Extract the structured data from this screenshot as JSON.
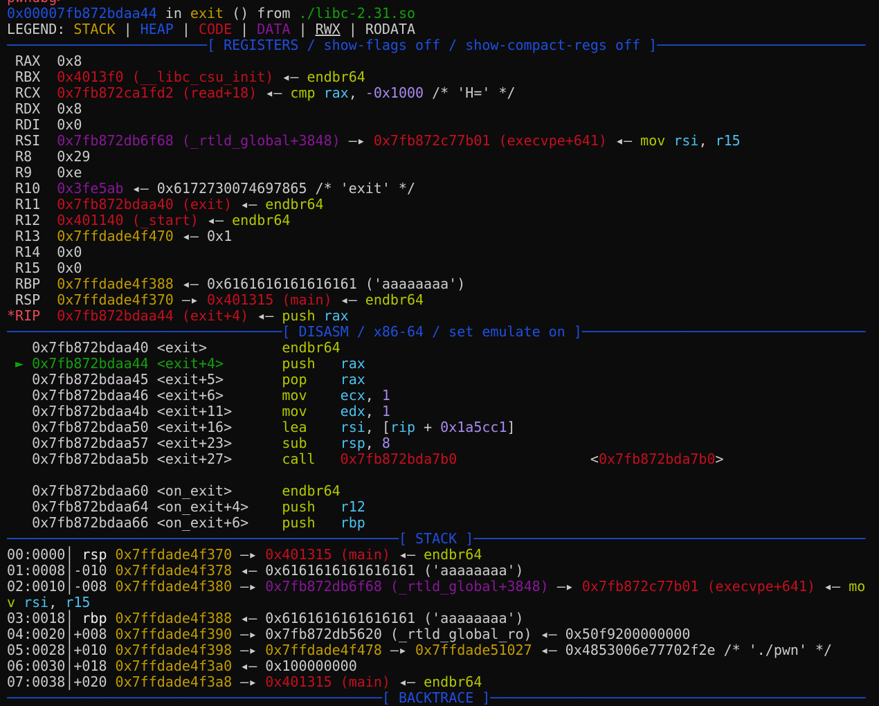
{
  "terminal": {
    "colors": {
      "blue": "#1f4fe0",
      "red": "#c50f1f",
      "green": "#13a10e",
      "yellow": "#c19c00",
      "purple": "#881798",
      "lime": "#b4c800",
      "cyan": "#4cc2f0",
      "text": "#cccccc",
      "background": "#0c0c0c"
    },
    "lines": [
      {
        "s": [
          [
            "pwndbg>",
            "rr"
          ]
        ]
      },
      {
        "s": [
          [
            "0x00007fb872bdaa44",
            "b"
          ],
          [
            " in ",
            "w"
          ],
          [
            "exit",
            "y"
          ],
          [
            " () from ",
            "w"
          ],
          [
            "./libc-2.31.so",
            "g"
          ]
        ]
      },
      {
        "s": [
          [
            "LEGEND: ",
            "w"
          ],
          [
            "STACK",
            "y"
          ],
          [
            " | ",
            "w"
          ],
          [
            "HEAP",
            "b"
          ],
          [
            " | ",
            "w"
          ],
          [
            "CODE",
            "r"
          ],
          [
            " | ",
            "w"
          ],
          [
            "DATA",
            "m"
          ],
          [
            " | ",
            "w"
          ],
          [
            "RWX",
            "w u"
          ],
          [
            " | ",
            "w"
          ],
          [
            "RODATA",
            "w"
          ]
        ]
      },
      {
        "sep": "[ REGISTERS / show-flags off / show-compact-regs off ]"
      },
      {
        "s": [
          [
            " RAX  0x8",
            "w"
          ]
        ]
      },
      {
        "s": [
          [
            " RBX  ",
            "w"
          ],
          [
            "0x4013f0 (__libc_csu_init)",
            "r"
          ],
          [
            " ◂— ",
            "w"
          ],
          [
            "endbr64",
            "yg"
          ]
        ]
      },
      {
        "s": [
          [
            " RCX  ",
            "w"
          ],
          [
            "0x7fb872ca1fd2 (read+18)",
            "r"
          ],
          [
            " ◂— ",
            "w"
          ],
          [
            "cmp ",
            "yg"
          ],
          [
            "rax",
            "c"
          ],
          [
            ", ",
            "w"
          ],
          [
            "-0x1000",
            "p"
          ],
          [
            " /* 'H=' */",
            "w"
          ]
        ]
      },
      {
        "s": [
          [
            " RDX  0x8",
            "w"
          ]
        ]
      },
      {
        "s": [
          [
            " RDI  0x0",
            "w"
          ]
        ]
      },
      {
        "s": [
          [
            " RSI  ",
            "w"
          ],
          [
            "0x7fb872db6f68 (_rtld_global+3848)",
            "m"
          ],
          [
            " —▸ ",
            "w"
          ],
          [
            "0x7fb872c77b01 (execvpe+641)",
            "r"
          ],
          [
            " ◂— ",
            "w"
          ],
          [
            "mov ",
            "yg"
          ],
          [
            "rsi",
            "c"
          ],
          [
            ", ",
            "w"
          ],
          [
            "r15",
            "c"
          ]
        ]
      },
      {
        "s": [
          [
            " R8   0x29",
            "w"
          ]
        ]
      },
      {
        "s": [
          [
            " R9   0xe",
            "w"
          ]
        ]
      },
      {
        "s": [
          [
            " R10  ",
            "w"
          ],
          [
            "0x3fe5ab",
            "m"
          ],
          [
            " ◂— 0x6172730074697865 /* 'exit' */",
            "w"
          ]
        ]
      },
      {
        "s": [
          [
            " R11  ",
            "w"
          ],
          [
            "0x7fb872bdaa40 (exit)",
            "r"
          ],
          [
            " ◂— ",
            "w"
          ],
          [
            "endbr64",
            "yg"
          ]
        ]
      },
      {
        "s": [
          [
            " R12  ",
            "w"
          ],
          [
            "0x401140 (_start)",
            "r"
          ],
          [
            " ◂— ",
            "w"
          ],
          [
            "endbr64",
            "yg"
          ]
        ]
      },
      {
        "s": [
          [
            " R13  ",
            "w"
          ],
          [
            "0x7ffdade4f470",
            "y"
          ],
          [
            " ◂— 0x1",
            "w"
          ]
        ]
      },
      {
        "s": [
          [
            " R14  0x0",
            "w"
          ]
        ]
      },
      {
        "s": [
          [
            " R15  0x0",
            "w"
          ]
        ]
      },
      {
        "s": [
          [
            " RBP  ",
            "w"
          ],
          [
            "0x7ffdade4f388",
            "y"
          ],
          [
            " ◂— 0x6161616161616161 ('aaaaaaaa')",
            "w"
          ]
        ]
      },
      {
        "s": [
          [
            " RSP  ",
            "w"
          ],
          [
            "0x7ffdade4f370",
            "y"
          ],
          [
            " —▸ ",
            "w"
          ],
          [
            "0x401315 (main)",
            "r"
          ],
          [
            " ◂— ",
            "w"
          ],
          [
            "endbr64",
            "yg"
          ]
        ]
      },
      {
        "s": [
          [
            "*RIP  ",
            "rr"
          ],
          [
            "0x7fb872bdaa44 (exit+4)",
            "r"
          ],
          [
            " ◂— ",
            "w"
          ],
          [
            "push ",
            "yg"
          ],
          [
            "rax",
            "c"
          ]
        ]
      },
      {
        "sep": "[ DISASM / x86-64 / set emulate on ]"
      },
      {
        "s": [
          [
            "   0x7fb872bdaa40 <exit>         ",
            "w"
          ],
          [
            "endbr64",
            "yg"
          ]
        ]
      },
      {
        "s": [
          [
            " ► ",
            "g"
          ],
          [
            "0x7fb872bdaa44 <exit+4>",
            "g"
          ],
          [
            "       ",
            "w"
          ],
          [
            "push   ",
            "yg"
          ],
          [
            "rax",
            "c"
          ]
        ]
      },
      {
        "s": [
          [
            "   0x7fb872bdaa45 <exit+5>       ",
            "w"
          ],
          [
            "pop    ",
            "yg"
          ],
          [
            "rax",
            "c"
          ]
        ]
      },
      {
        "s": [
          [
            "   0x7fb872bdaa46 <exit+6>       ",
            "w"
          ],
          [
            "mov    ",
            "yg"
          ],
          [
            "ecx",
            "c"
          ],
          [
            ", ",
            "w"
          ],
          [
            "1",
            "p"
          ]
        ]
      },
      {
        "s": [
          [
            "   0x7fb872bdaa4b <exit+11>      ",
            "w"
          ],
          [
            "mov    ",
            "yg"
          ],
          [
            "edx",
            "c"
          ],
          [
            ", ",
            "w"
          ],
          [
            "1",
            "p"
          ]
        ]
      },
      {
        "s": [
          [
            "   0x7fb872bdaa50 <exit+16>      ",
            "w"
          ],
          [
            "lea    ",
            "yg"
          ],
          [
            "rsi",
            "c"
          ],
          [
            ", [",
            "w"
          ],
          [
            "rip",
            "c"
          ],
          [
            " + ",
            "w"
          ],
          [
            "0x1a5cc1",
            "p"
          ],
          [
            "]",
            "w"
          ]
        ]
      },
      {
        "s": [
          [
            "   0x7fb872bdaa57 <exit+23>      ",
            "w"
          ],
          [
            "sub    ",
            "yg"
          ],
          [
            "rsp",
            "c"
          ],
          [
            ", ",
            "w"
          ],
          [
            "8",
            "p"
          ]
        ]
      },
      {
        "s": [
          [
            "   0x7fb872bdaa5b <exit+27>      ",
            "w"
          ],
          [
            "call   ",
            "yg"
          ],
          [
            "0x7fb872bda7b0",
            "r"
          ],
          [
            "                ",
            "w"
          ],
          [
            "<",
            "w"
          ],
          [
            "0x7fb872bda7b0",
            "r"
          ],
          [
            ">",
            "w"
          ]
        ]
      },
      {
        "s": [
          [
            "",
            "w"
          ]
        ]
      },
      {
        "s": [
          [
            "   0x7fb872bdaa60 <on_exit>      ",
            "w"
          ],
          [
            "endbr64",
            "yg"
          ]
        ]
      },
      {
        "s": [
          [
            "   0x7fb872bdaa64 <on_exit+4>    ",
            "w"
          ],
          [
            "push   ",
            "yg"
          ],
          [
            "r12",
            "c"
          ]
        ]
      },
      {
        "s": [
          [
            "   0x7fb872bdaa66 <on_exit+6>    ",
            "w"
          ],
          [
            "push   ",
            "yg"
          ],
          [
            "rbp",
            "c"
          ]
        ]
      },
      {
        "sep": "[ STACK ]"
      },
      {
        "s": [
          [
            "00:0000│ ",
            "w"
          ],
          [
            "rsp",
            "bw"
          ],
          [
            " ",
            "w"
          ],
          [
            "0x7ffdade4f370",
            "y"
          ],
          [
            " —▸ ",
            "w"
          ],
          [
            "0x401315 (main)",
            "r"
          ],
          [
            " ◂— ",
            "w"
          ],
          [
            "endbr64",
            "yg"
          ]
        ]
      },
      {
        "s": [
          [
            "01:0008│-010 ",
            "w"
          ],
          [
            "0x7ffdade4f378",
            "y"
          ],
          [
            " ◂— 0x6161616161616161 ('aaaaaaaa')",
            "w"
          ]
        ]
      },
      {
        "s": [
          [
            "02:0010│-008 ",
            "w"
          ],
          [
            "0x7ffdade4f380",
            "y"
          ],
          [
            " —▸ ",
            "w"
          ],
          [
            "0x7fb872db6f68 (_rtld_global+3848)",
            "m"
          ],
          [
            " —▸ ",
            "w"
          ],
          [
            "0x7fb872c77b01 (execvpe+641)",
            "r"
          ],
          [
            " ◂— ",
            "w"
          ],
          [
            "mo",
            "yg"
          ]
        ]
      },
      {
        "s": [
          [
            "v ",
            "yg"
          ],
          [
            "rsi",
            "c"
          ],
          [
            ", ",
            "w"
          ],
          [
            "r15",
            "c"
          ]
        ]
      },
      {
        "s": [
          [
            "03:0018│ ",
            "w"
          ],
          [
            "rbp",
            "bw"
          ],
          [
            " ",
            "w"
          ],
          [
            "0x7ffdade4f388",
            "y"
          ],
          [
            " ◂— 0x6161616161616161 ('aaaaaaaa')",
            "w"
          ]
        ]
      },
      {
        "s": [
          [
            "04:0020│+008 ",
            "w"
          ],
          [
            "0x7ffdade4f390",
            "y"
          ],
          [
            " —▸ 0x7fb872db5620 (_rtld_global_ro) ◂— 0x50f9200000000",
            "w"
          ]
        ]
      },
      {
        "s": [
          [
            "05:0028│+010 ",
            "w"
          ],
          [
            "0x7ffdade4f398",
            "y"
          ],
          [
            " —▸ ",
            "w"
          ],
          [
            "0x7ffdade4f478",
            "y"
          ],
          [
            " —▸ ",
            "w"
          ],
          [
            "0x7ffdade51027",
            "y"
          ],
          [
            " ◂— 0x4853006e77702f2e /* './pwn' */",
            "w"
          ]
        ]
      },
      {
        "s": [
          [
            "06:0030│+018 ",
            "w"
          ],
          [
            "0x7ffdade4f3a0",
            "y"
          ],
          [
            " ◂— 0x100000000",
            "w"
          ]
        ]
      },
      {
        "s": [
          [
            "07:0038│+020 ",
            "w"
          ],
          [
            "0x7ffdade4f3a8",
            "y"
          ],
          [
            " —▸ ",
            "w"
          ],
          [
            "0x401315 (main)",
            "r"
          ],
          [
            " ◂— ",
            "w"
          ],
          [
            "endbr64",
            "yg"
          ]
        ]
      },
      {
        "sep": "[ BACKTRACE ]"
      }
    ]
  }
}
